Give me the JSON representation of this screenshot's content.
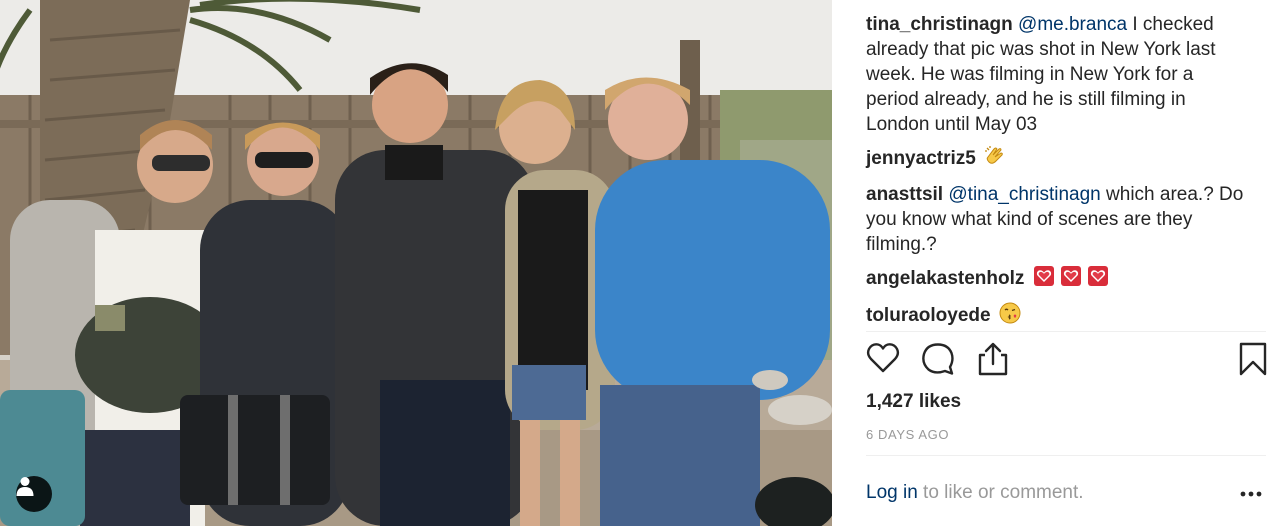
{
  "post": {
    "photo_alt": "",
    "comments": [
      {
        "username": "tina_christinagn",
        "mention": "@me.branca",
        "text": " I checked already that pic was shot in New York last week. He was filming in New York for a period already, and he is still filming in London until May 03"
      },
      {
        "username": "jennyactriz5",
        "emoji": "clapping-hands"
      },
      {
        "username": "anasttsil",
        "mention": "@tina_christinagn",
        "text": " which area.? Do you know what kind of scenes are they filming.?"
      },
      {
        "username": "angelakastenholz",
        "emoji": "heart-box x3"
      },
      {
        "username": "toluraoloyede",
        "emoji": "kissing-face"
      }
    ],
    "actions": {
      "like_icon": "heart-icon",
      "comment_icon": "speech-bubble-icon",
      "share_icon": "share-icon",
      "save_icon": "bookmark-icon"
    },
    "likes_count": "1,427",
    "likes_label": "likes",
    "time_ago": "6 DAYS AGO",
    "footer": {
      "login_link": "Log in",
      "login_rest": " to like or comment.",
      "more_icon": "ellipsis-icon"
    },
    "colors": {
      "text": "#262626",
      "mention": "#003569",
      "muted": "#999999",
      "divider": "#efefef"
    }
  }
}
